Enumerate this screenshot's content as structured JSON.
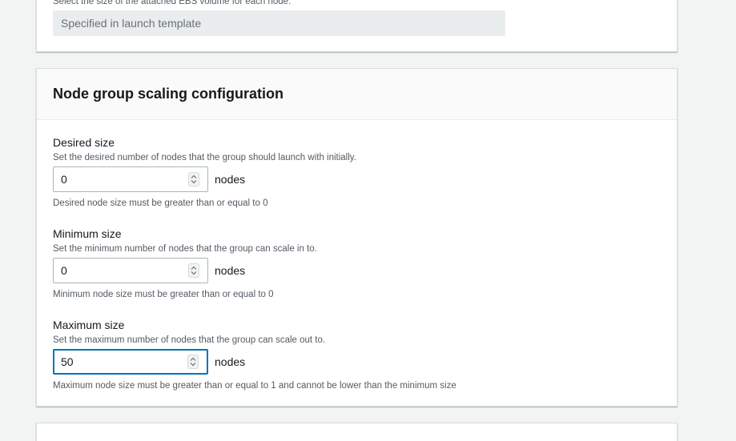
{
  "volume_size": {
    "description": "Select the size of the attached EBS volume for each node.",
    "value": "Specified in launch template"
  },
  "scaling": {
    "title": "Node group scaling configuration",
    "desired": {
      "label": "Desired size",
      "description": "Set the desired number of nodes that the group should launch with initially.",
      "value": "0",
      "unit": "nodes",
      "constraint": "Desired node size must be greater than or equal to 0"
    },
    "minimum": {
      "label": "Minimum size",
      "description": "Set the minimum number of nodes that the group can scale in to.",
      "value": "0",
      "unit": "nodes",
      "constraint": "Minimum node size must be greater than or equal to 0"
    },
    "maximum": {
      "label": "Maximum size",
      "description": "Set the maximum number of nodes that the group can scale out to.",
      "value": "50",
      "unit": "nodes",
      "constraint": "Maximum node size must be greater than or equal to 1 and cannot be lower than the minimum size"
    }
  },
  "colors": {
    "focus_border": "#0073bb",
    "page_background": "#f2f3f3",
    "disabled_field": "#eaeded"
  },
  "icons": {
    "spinner": "up-down-chevron-icon"
  }
}
